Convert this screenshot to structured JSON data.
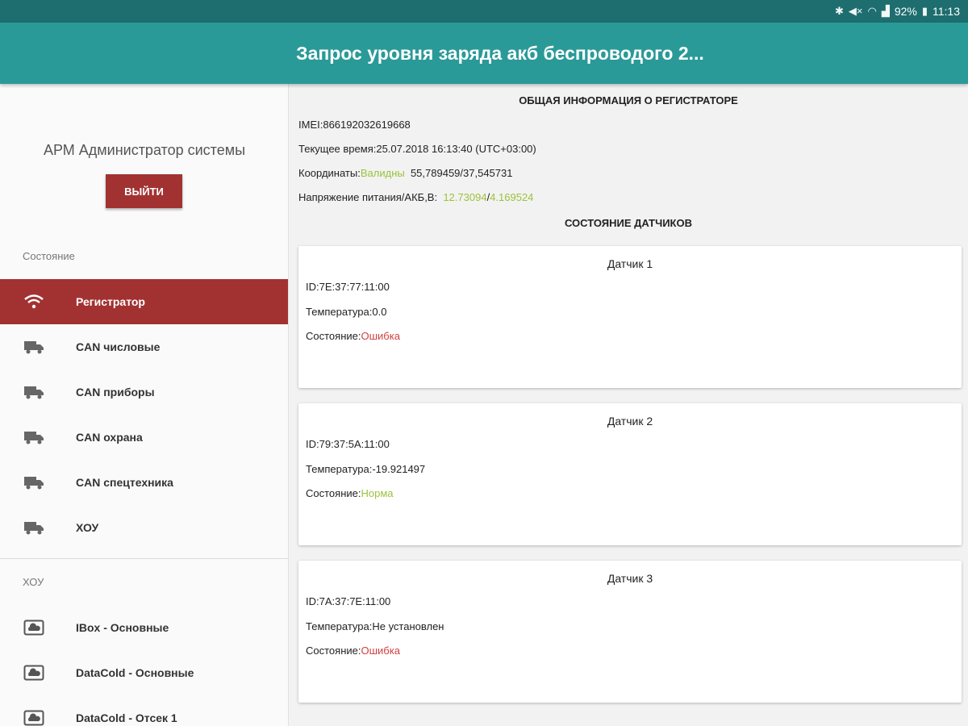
{
  "statusbar": {
    "icons": [
      "bluetooth-icon",
      "mute-icon",
      "wifi-icon",
      "signal-icon"
    ],
    "battery": "92%",
    "time": "11:13"
  },
  "appbar": {
    "title": "Запрос уровня заряда акб беспроводого 2..."
  },
  "sidebar": {
    "user": "АРМ Администратор системы",
    "logout_label": "ВЫЙТИ",
    "section_state": "Состояние",
    "items": [
      {
        "label": "Регистратор",
        "icon": "wifi-icon",
        "active": true
      },
      {
        "label": "CAN числовые",
        "icon": "truck-icon"
      },
      {
        "label": "CAN приборы",
        "icon": "truck-icon"
      },
      {
        "label": "CAN охрана",
        "icon": "truck-icon"
      },
      {
        "label": "CAN спецтехника",
        "icon": "truck-icon"
      },
      {
        "label": "ХОУ",
        "icon": "truck-icon"
      }
    ],
    "section_xou": "ХОУ",
    "xou_items": [
      {
        "label": "IBox - Основные",
        "icon": "cloud-icon"
      },
      {
        "label": "DataCold - Основные",
        "icon": "cloud-icon"
      },
      {
        "label": "DataCold - Отсек 1",
        "icon": "cloud-icon"
      }
    ]
  },
  "main": {
    "general_title": "ОБЩАЯ ИНФОРМАЦИЯ О РЕГИСТРАТОРЕ",
    "imei": "IMEI:866192032619668",
    "time": "Текущее время:25.07.2018 16:13:40 (UTC+03:00)",
    "coords_label": "Координаты:",
    "coords_status": "Валидны",
    "coords_value": "55,789459/37,545731",
    "voltage_label": "Напряжение питания/АКБ,В:",
    "voltage_main": "12.73094",
    "voltage_sep": "/",
    "voltage_battery": "4.169524",
    "sensors_title": "СОСТОЯНИЕ ДАТЧИКОВ",
    "sensors": [
      {
        "title": "Датчик 1",
        "id": "ID:7E:37:77:11:00",
        "temp": "Температура:0.0",
        "state_label": "Состояние:",
        "state": "Ошибка",
        "ok": false
      },
      {
        "title": "Датчик 2",
        "id": "ID:79:37:5A:11:00",
        "temp": "Температура:-19.921497",
        "state_label": "Состояние:",
        "state": "Норма",
        "ok": true
      },
      {
        "title": "Датчик 3",
        "id": "ID:7A:37:7E:11:00",
        "temp": "Температура:Не установлен",
        "state_label": "Состояние:",
        "state": "Ошибка",
        "ok": false
      }
    ]
  },
  "colors": {
    "appbar": "#2a9a98",
    "statusbar": "#1e6e70",
    "accent": "#a23232",
    "ok": "#9cc23a",
    "error": "#d04040"
  }
}
